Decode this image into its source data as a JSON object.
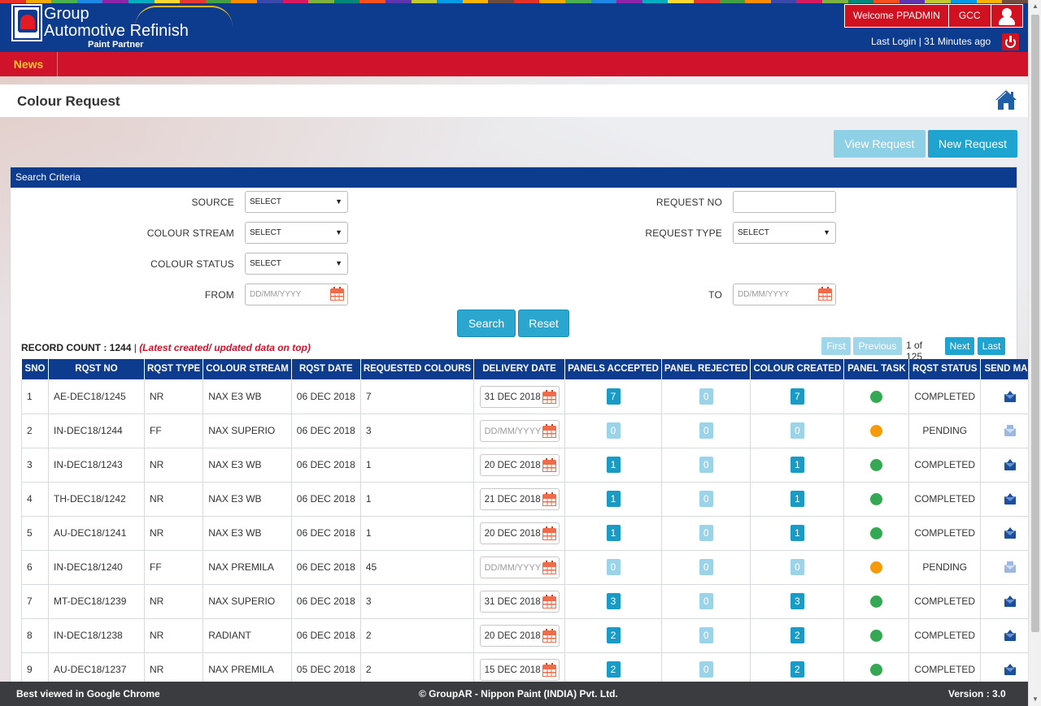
{
  "header": {
    "logo_line1": "Group",
    "logo_line2": "Automotive Refinish",
    "logo_line3": "Paint Partner",
    "welcome": "Welcome PPADMIN",
    "region": "GCC",
    "last_login": "Last Login | 31 Minutes ago",
    "stripe_colors": [
      "#e4322b",
      "#f2a900",
      "#4caf50",
      "#1e88e5",
      "#8e24aa",
      "#00acc1",
      "#fdd835",
      "#e53935",
      "#43a047",
      "#fb8c00",
      "#3949ab",
      "#d81b60",
      "#7cb342",
      "#00897b",
      "#f4511e",
      "#5e35b1",
      "#c0ca33",
      "#039be5",
      "#ffb300",
      "#6d4c41",
      "#e4322b",
      "#f2a900",
      "#4caf50",
      "#1e88e5",
      "#8e24aa",
      "#00acc1",
      "#fdd835",
      "#e53935",
      "#43a047",
      "#fb8c00",
      "#3949ab",
      "#d81b60",
      "#7cb342",
      "#00897b",
      "#f4511e",
      "#5e35b1",
      "#c0ca33",
      "#039be5",
      "#ffb300",
      "#6d4c41"
    ]
  },
  "nav": {
    "news": "News"
  },
  "page": {
    "title": "Colour Request",
    "view_request": "View Request",
    "new_request": "New Request"
  },
  "search": {
    "heading": "Search Criteria",
    "source_label": "SOURCE",
    "source_value": "SELECT",
    "colour_stream_label": "COLOUR STREAM",
    "colour_stream_value": "SELECT",
    "colour_status_label": "COLOUR STATUS",
    "colour_status_value": "SELECT",
    "from_label": "FROM",
    "from_placeholder": "DD/MM/YYYY",
    "request_no_label": "REQUEST NO",
    "request_no_value": "",
    "request_type_label": "REQUEST TYPE",
    "request_type_value": "SELECT",
    "to_label": "TO",
    "to_placeholder": "DD/MM/YYYY",
    "search_btn": "Search",
    "reset_btn": "Reset"
  },
  "records": {
    "count_label": "RECORD COUNT :",
    "count": "1244",
    "separator": "|",
    "note": "(Latest created/ updated data on top)"
  },
  "pager": {
    "first": "First",
    "previous": "Previous",
    "info": "1 of 125",
    "next": "Next",
    "last": "Last"
  },
  "table": {
    "columns": [
      "SNO",
      "RQST NO",
      "RQST TYPE",
      "COLOUR STREAM",
      "RQST DATE",
      "REQUESTED COLOURS",
      "DELIVERY DATE",
      "PANELS ACCEPTED",
      "PANEL REJECTED",
      "COLOUR CREATED",
      "PANEL TASK",
      "RQST STATUS",
      "SEND MAIL"
    ],
    "rows": [
      {
        "sno": "1",
        "rqst_no": "AE-DEC18/1245",
        "type": "NR",
        "stream": "NAX E3 WB",
        "date": "06 DEC 2018",
        "colours": "7",
        "delivery": "31 DEC 2018",
        "accepted": "7",
        "rejected": "0",
        "created": "7",
        "task": "green",
        "status": "COMPLETED",
        "mail_enabled": true
      },
      {
        "sno": "2",
        "rqst_no": "IN-DEC18/1244",
        "type": "FF",
        "stream": "NAX SUPERIO",
        "date": "06 DEC 2018",
        "colours": "3",
        "delivery": "",
        "accepted": "0",
        "rejected": "0",
        "created": "0",
        "task": "orange",
        "status": "PENDING",
        "mail_enabled": false
      },
      {
        "sno": "3",
        "rqst_no": "IN-DEC18/1243",
        "type": "NR",
        "stream": "NAX E3 WB",
        "date": "06 DEC 2018",
        "colours": "1",
        "delivery": "20 DEC 2018",
        "accepted": "1",
        "rejected": "0",
        "created": "1",
        "task": "green",
        "status": "COMPLETED",
        "mail_enabled": true
      },
      {
        "sno": "4",
        "rqst_no": "TH-DEC18/1242",
        "type": "NR",
        "stream": "NAX E3 WB",
        "date": "06 DEC 2018",
        "colours": "1",
        "delivery": "21 DEC 2018",
        "accepted": "1",
        "rejected": "0",
        "created": "1",
        "task": "green",
        "status": "COMPLETED",
        "mail_enabled": true
      },
      {
        "sno": "5",
        "rqst_no": "AU-DEC18/1241",
        "type": "NR",
        "stream": "NAX E3 WB",
        "date": "06 DEC 2018",
        "colours": "1",
        "delivery": "20 DEC 2018",
        "accepted": "1",
        "rejected": "0",
        "created": "1",
        "task": "green",
        "status": "COMPLETED",
        "mail_enabled": true
      },
      {
        "sno": "6",
        "rqst_no": "IN-DEC18/1240",
        "type": "FF",
        "stream": "NAX PREMILA",
        "date": "06 DEC 2018",
        "colours": "45",
        "delivery": "",
        "accepted": "0",
        "rejected": "0",
        "created": "0",
        "task": "orange",
        "status": "PENDING",
        "mail_enabled": false
      },
      {
        "sno": "7",
        "rqst_no": "MT-DEC18/1239",
        "type": "NR",
        "stream": "NAX SUPERIO",
        "date": "06 DEC 2018",
        "colours": "3",
        "delivery": "31 DEC 2018",
        "accepted": "3",
        "rejected": "0",
        "created": "3",
        "task": "green",
        "status": "COMPLETED",
        "mail_enabled": true
      },
      {
        "sno": "8",
        "rqst_no": "IN-DEC18/1238",
        "type": "NR",
        "stream": "RADIANT",
        "date": "06 DEC 2018",
        "colours": "2",
        "delivery": "20 DEC 2018",
        "accepted": "2",
        "rejected": "0",
        "created": "2",
        "task": "green",
        "status": "COMPLETED",
        "mail_enabled": true
      },
      {
        "sno": "9",
        "rqst_no": "AU-DEC18/1237",
        "type": "NR",
        "stream": "NAX PREMILA",
        "date": "05 DEC 2018",
        "colours": "2",
        "delivery": "15 DEC 2018",
        "accepted": "2",
        "rejected": "0",
        "created": "2",
        "task": "green",
        "status": "COMPLETED",
        "mail_enabled": true
      }
    ],
    "delivery_placeholder": "DD/MM/YYYY"
  },
  "footer": {
    "left": "Best viewed in Google Chrome",
    "center": "© GroupAR - Nippon Paint (INDIA) Pvt. Ltd.",
    "right": "Version : 3.0"
  },
  "colors": {
    "brand_blue": "#0d3c8f",
    "brand_red": "#d0122a",
    "news_yellow": "#ffc72c",
    "accent": "#1fa3cf",
    "task_green": "#34a853",
    "task_orange": "#f59b0b"
  }
}
